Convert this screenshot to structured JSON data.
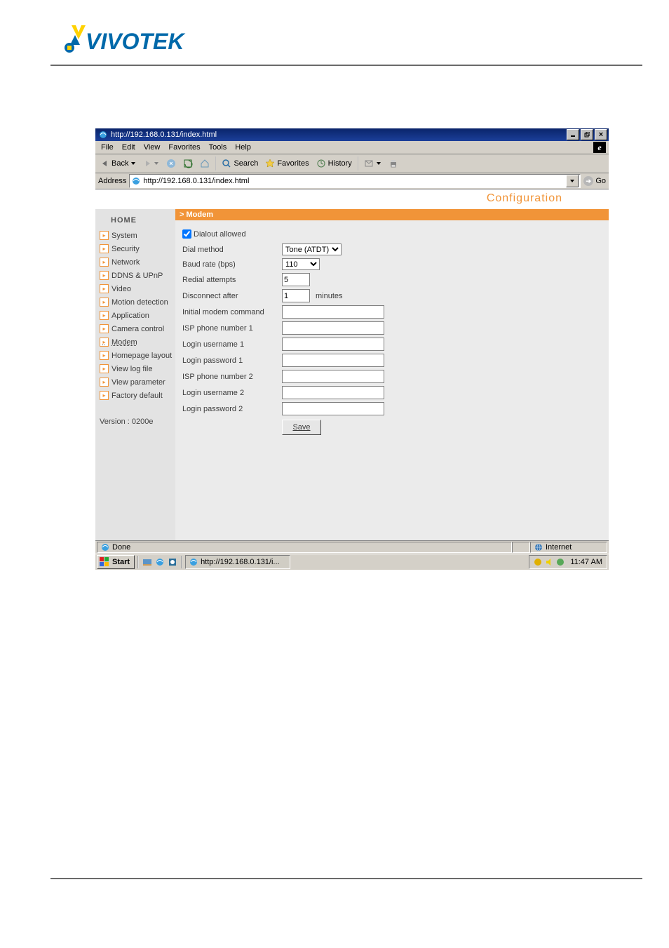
{
  "window": {
    "title": "http://192.168.0.131/index.html",
    "minimize": "_",
    "restore": "❐",
    "close": "×"
  },
  "menubar": [
    "File",
    "Edit",
    "View",
    "Favorites",
    "Tools",
    "Help"
  ],
  "toolbar": {
    "back": "Back",
    "search": "Search",
    "favorites": "Favorites",
    "history": "History"
  },
  "addressbar": {
    "label": "Address",
    "url": "http://192.168.0.131/index.html",
    "go": "Go"
  },
  "config": {
    "title": "Configuration"
  },
  "sidebar": {
    "home": "HOME",
    "items": [
      {
        "label": "System"
      },
      {
        "label": "Security"
      },
      {
        "label": "Network"
      },
      {
        "label": "DDNS & UPnP"
      },
      {
        "label": "Video"
      },
      {
        "label": "Motion detection"
      },
      {
        "label": "Application"
      },
      {
        "label": "Camera control"
      },
      {
        "label": "Modem",
        "selected": true
      },
      {
        "label": "Homepage layout"
      },
      {
        "label": "View log file"
      },
      {
        "label": "View parameter"
      },
      {
        "label": "Factory default"
      }
    ],
    "version": "Version : 0200e"
  },
  "form": {
    "section_title": "> Modem",
    "dialout_label": "Dialout allowed",
    "dialout_checked": true,
    "dial_method_label": "Dial method",
    "dial_method_value": "Tone (ATDT)",
    "baud_label": "Baud rate (bps)",
    "baud_value": "110",
    "redial_label": "Redial attempts",
    "redial_value": "5",
    "disconnect_label": "Disconnect after",
    "disconnect_value": "1",
    "disconnect_unit": "minutes",
    "init_cmd_label": "Initial modem command",
    "init_cmd_value": "",
    "isp1_label": "ISP phone number 1",
    "isp1_value": "",
    "user1_label": "Login username 1",
    "user1_value": "",
    "pass1_label": "Login password 1",
    "pass1_value": "",
    "isp2_label": "ISP phone number 2",
    "isp2_value": "",
    "user2_label": "Login username 2",
    "user2_value": "",
    "pass2_label": "Login password 2",
    "pass2_value": "",
    "save": "Save"
  },
  "statusbar": {
    "status": "Done",
    "zone": "Internet"
  },
  "taskbar": {
    "start": "Start",
    "active_task": "http://192.168.0.131/i...",
    "clock": "11:47 AM"
  }
}
